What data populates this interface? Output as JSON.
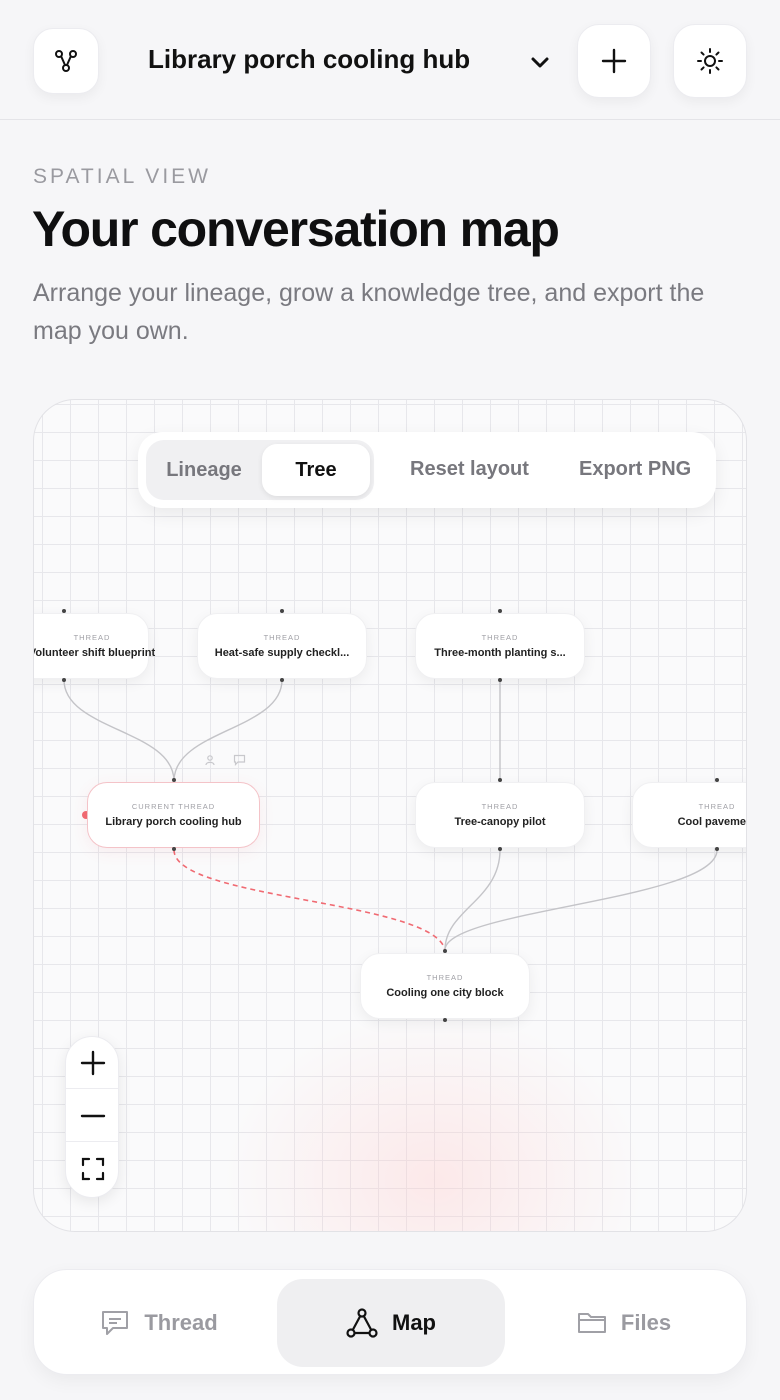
{
  "header": {
    "project_title": "Library porch cooling hub",
    "icons": {
      "logo": "graph-nodes-icon",
      "dropdown": "chevron-down-icon",
      "add": "plus-icon",
      "settings": "sun-icon"
    }
  },
  "intro": {
    "eyebrow": "SPATIAL VIEW",
    "title": "Your conversation map",
    "description": "Arrange your lineage, grow a knowledge tree, and export the map you own."
  },
  "toolbar": {
    "view_modes": [
      {
        "label": "Lineage",
        "active": false
      },
      {
        "label": "Tree",
        "active": true
      }
    ],
    "reset_label": "Reset layout",
    "export_label": "Export PNG"
  },
  "map": {
    "nodes": [
      {
        "kind": "THREAD",
        "title": "Volunteer shift blueprint"
      },
      {
        "kind": "THREAD",
        "title": "Heat-safe supply checkl..."
      },
      {
        "kind": "THREAD",
        "title": "Three-month planting s..."
      },
      {
        "kind": "CURRENT THREAD",
        "title": "Library porch cooling hub"
      },
      {
        "kind": "THREAD",
        "title": "Tree-canopy pilot"
      },
      {
        "kind": "THREAD",
        "title": "Cool pavement"
      },
      {
        "kind": "THREAD",
        "title": "Cooling one city block"
      }
    ],
    "accent_color": "#f06a72"
  },
  "zoom_controls": {
    "icons": [
      "plus-icon",
      "minus-icon",
      "fit-screen-icon"
    ]
  },
  "bottom_nav": {
    "tabs": [
      {
        "label": "Thread",
        "icon": "chat-bubble-icon",
        "active": false
      },
      {
        "label": "Map",
        "icon": "triangle-nodes-icon",
        "active": true
      },
      {
        "label": "Files",
        "icon": "folder-icon",
        "active": false
      }
    ]
  }
}
